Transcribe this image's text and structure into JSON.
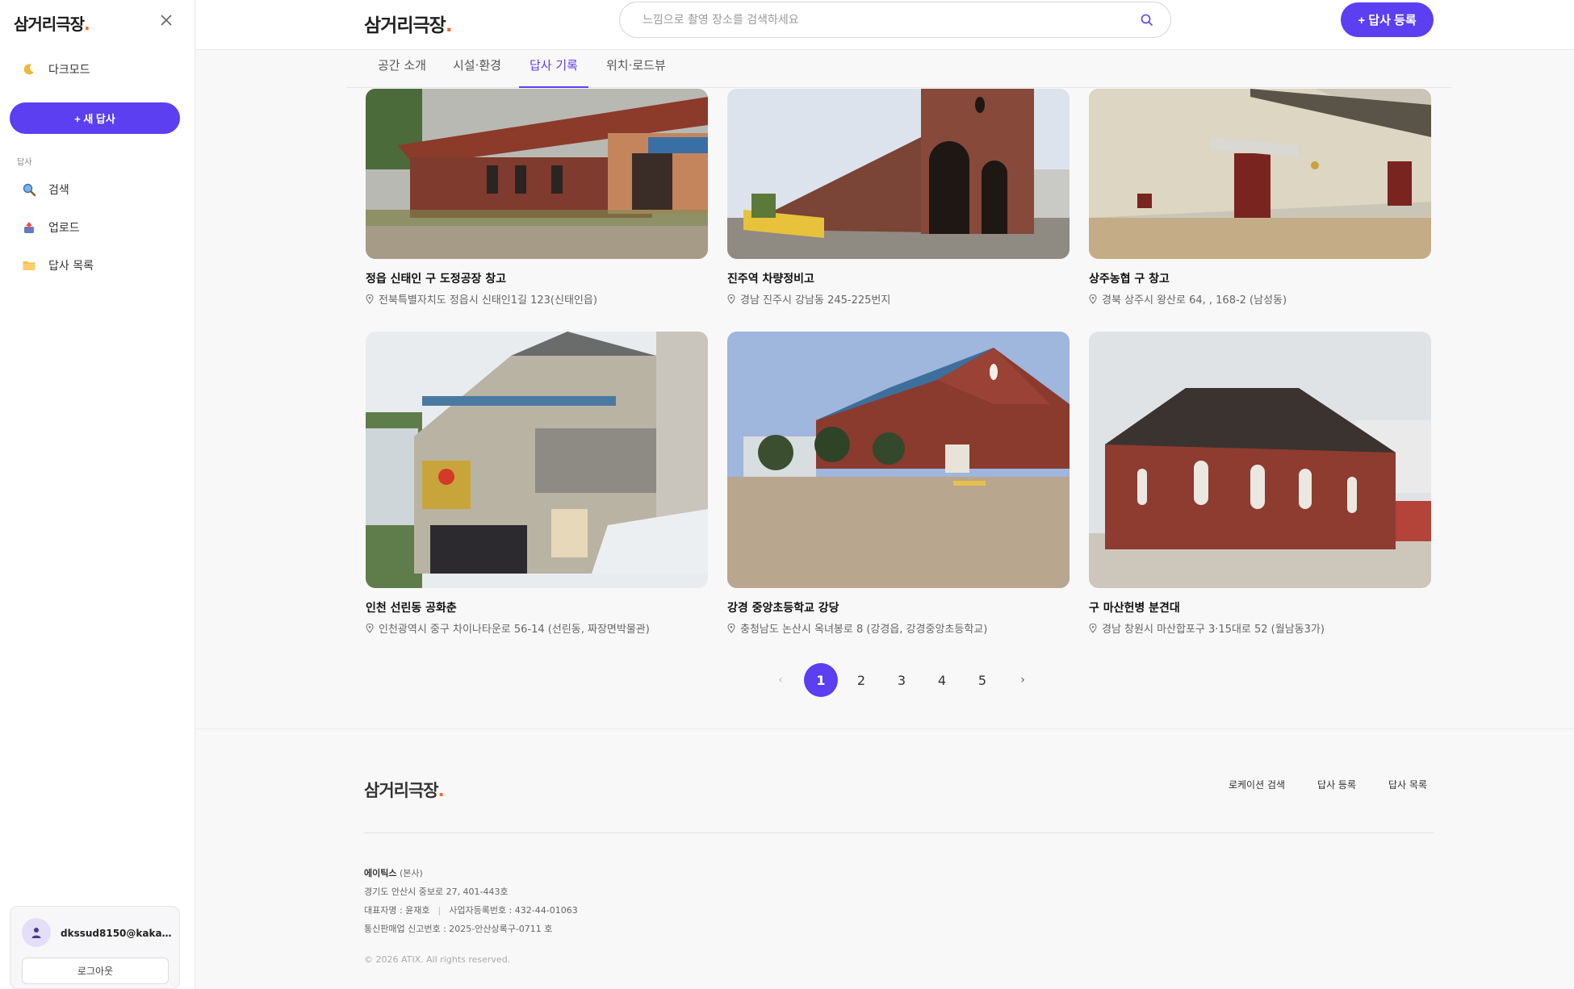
{
  "brand": {
    "name": "삼거리극장",
    "dot": "."
  },
  "sidebar": {
    "dark_mode_label": "다크모드",
    "new_button": "+ 새 답사",
    "section_label": "답사",
    "items": [
      {
        "label": "검색",
        "icon": "magnifier-icon"
      },
      {
        "label": "업로드",
        "icon": "upload-icon"
      },
      {
        "label": "답사 목록",
        "icon": "folder-icon"
      }
    ],
    "user_email": "dkssud8150@kakao...",
    "logout_label": "로그아웃"
  },
  "header": {
    "search_placeholder": "느낌으로 촬영 장소를 검색하세요",
    "register_button": "+ 답사 등록"
  },
  "tabs": [
    {
      "label": "공간 소개",
      "active": false
    },
    {
      "label": "시설·환경",
      "active": false
    },
    {
      "label": "답사 기록",
      "active": true
    },
    {
      "label": "위치·로드뷰",
      "active": false
    }
  ],
  "cards": [
    {
      "title": "정읍 신태인 구 도정공장 창고",
      "address": "전북특별자치도 정읍시 신태인1길 123(신태인읍)"
    },
    {
      "title": "진주역 차량정비고",
      "address": "경남 진주시 강남동 245-225번지"
    },
    {
      "title": "상주농협 구 창고",
      "address": "경북 상주시 왕산로 64, , 168-2 (남성동)"
    },
    {
      "title": "인천 선린동 공화춘",
      "address": "인천광역시 중구 차이나타운로 56-14 (선린동, 짜장면박물관)"
    },
    {
      "title": "강경 중앙초등학교 강당",
      "address": "충청남도 논산시 옥녀봉로 8 (강경읍, 강경중앙초등학교)"
    },
    {
      "title": "구 마산헌병 분견대",
      "address": "경남 창원시 마산합포구 3·15대로 52 (월남동3가)"
    }
  ],
  "pagination": {
    "prev": "‹",
    "pages": [
      "1",
      "2",
      "3",
      "4",
      "5"
    ],
    "current": "1",
    "next": "›"
  },
  "footer": {
    "links": [
      "로케이션 검색",
      "답사 등록",
      "답사 목록"
    ],
    "company": "에이틱스",
    "company_sub": "(본사)",
    "address": "경기도 안산시 중보로 27, 401-443호",
    "ceo": "대표자명 : 윤재호",
    "business_no": "사업자등록번호 : 432-44-01063",
    "telecom_no": "통신판매업 신고번호 : 2025-안산상록구-0711 호",
    "copyright": "© 2026 ATIX. All rights reserved."
  },
  "colors": {
    "accent": "#5b3ff0",
    "brand_dot": "#f26a2e"
  }
}
